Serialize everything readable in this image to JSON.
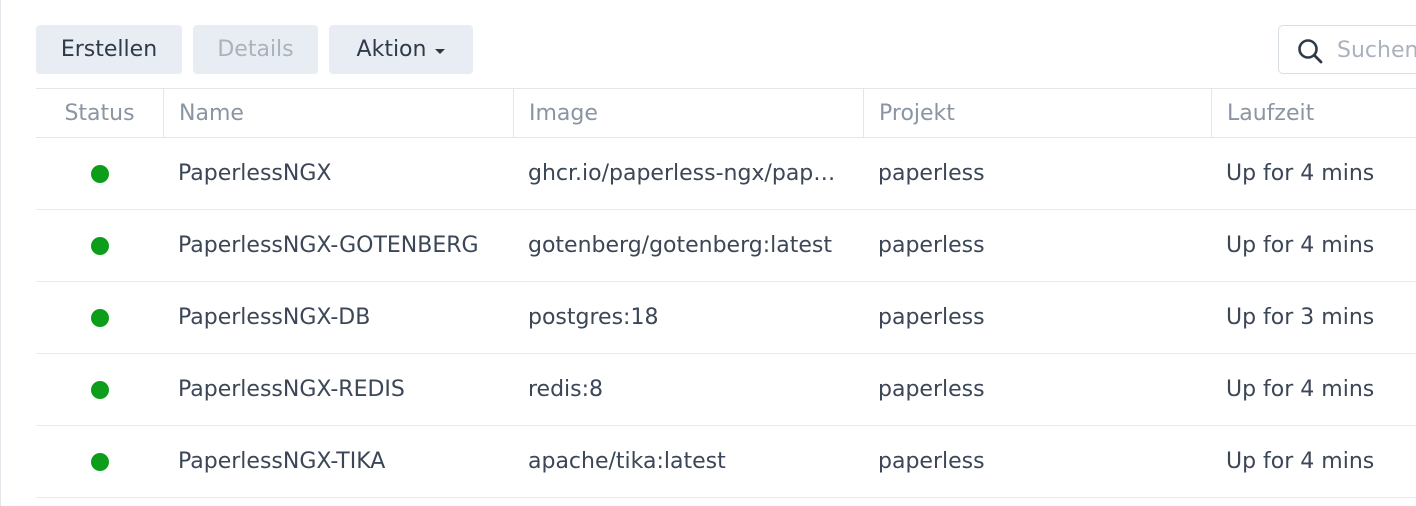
{
  "toolbar": {
    "create_label": "Erstellen",
    "details_label": "Details",
    "action_label": "Aktion"
  },
  "search": {
    "placeholder": "Suchen"
  },
  "table": {
    "columns": [
      "Status",
      "Name",
      "Image",
      "Projekt",
      "Laufzeit"
    ],
    "rows": [
      {
        "status": "running",
        "name": "PaperlessNGX",
        "image": "ghcr.io/paperless-ngx/pap…",
        "project": "paperless",
        "runtime": "Up for 4 mins"
      },
      {
        "status": "running",
        "name": "PaperlessNGX-GOTENBERG",
        "image": "gotenberg/gotenberg:latest",
        "project": "paperless",
        "runtime": "Up for 4 mins"
      },
      {
        "status": "running",
        "name": "PaperlessNGX-DB",
        "image": "postgres:18",
        "project": "paperless",
        "runtime": "Up for 3 mins"
      },
      {
        "status": "running",
        "name": "PaperlessNGX-REDIS",
        "image": "redis:8",
        "project": "paperless",
        "runtime": "Up for 4 mins"
      },
      {
        "status": "running",
        "name": "PaperlessNGX-TIKA",
        "image": "apache/tika:latest",
        "project": "paperless",
        "runtime": "Up for 4 mins"
      }
    ]
  },
  "colors": {
    "status_running": "#0c9d1a",
    "button_bg": "#e8edf3",
    "header_text": "#8a95a3",
    "body_text": "#3b4656"
  }
}
